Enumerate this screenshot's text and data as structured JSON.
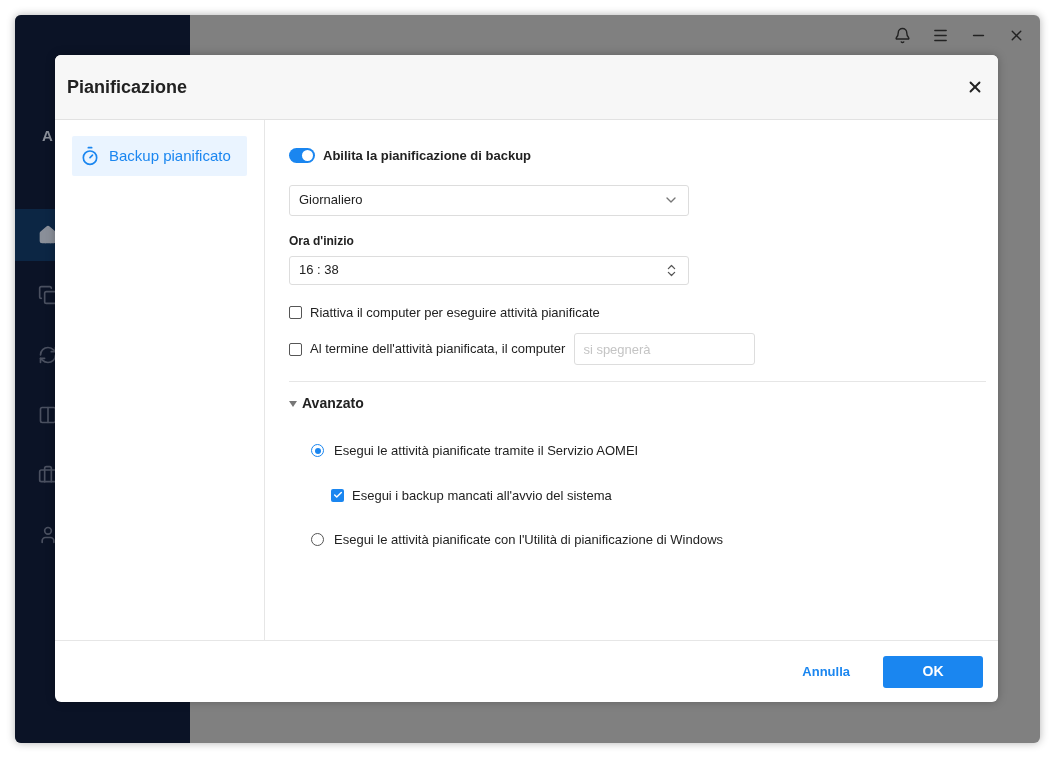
{
  "app": {
    "logo_text": "A",
    "nav": [
      {
        "selected": true
      },
      {
        "selected": false
      },
      {
        "selected": false
      },
      {
        "selected": false
      },
      {
        "selected": false
      },
      {
        "selected": false
      }
    ]
  },
  "dialog": {
    "title": "Pianificazione",
    "sidebar": [
      {
        "label": "Backup pianificato",
        "selected": true
      }
    ],
    "schedule_toggle": {
      "label": "Abilita la pianificazione di backup",
      "on": true
    },
    "frequency": {
      "value": "Giornaliero"
    },
    "start_time": {
      "label": "Ora d'inizio",
      "value": "16 : 38"
    },
    "options": [
      {
        "label": "Riattiva il computer per eseguire attività pianificate",
        "checked": false
      },
      {
        "label": "Al termine dell'attività pianificata, il computer",
        "checked": false,
        "placeholder": "si spegnerà"
      }
    ],
    "advanced": {
      "label": "Avanzato",
      "expanded": true,
      "choices": [
        {
          "label": "Esegui le attività pianificate tramite il Servizio AOMEI",
          "selected": true,
          "children": [
            {
              "label": "Esegui i backup mancati all'avvio del sistema",
              "checked": true
            }
          ]
        },
        {
          "label": "Esegui le attività pianificate con l'Utilità di pianificazione di Windows",
          "selected": false
        }
      ]
    },
    "buttons": [
      {
        "label": "Annulla",
        "kind": "link"
      },
      {
        "label": "OK",
        "kind": "primary"
      }
    ]
  }
}
